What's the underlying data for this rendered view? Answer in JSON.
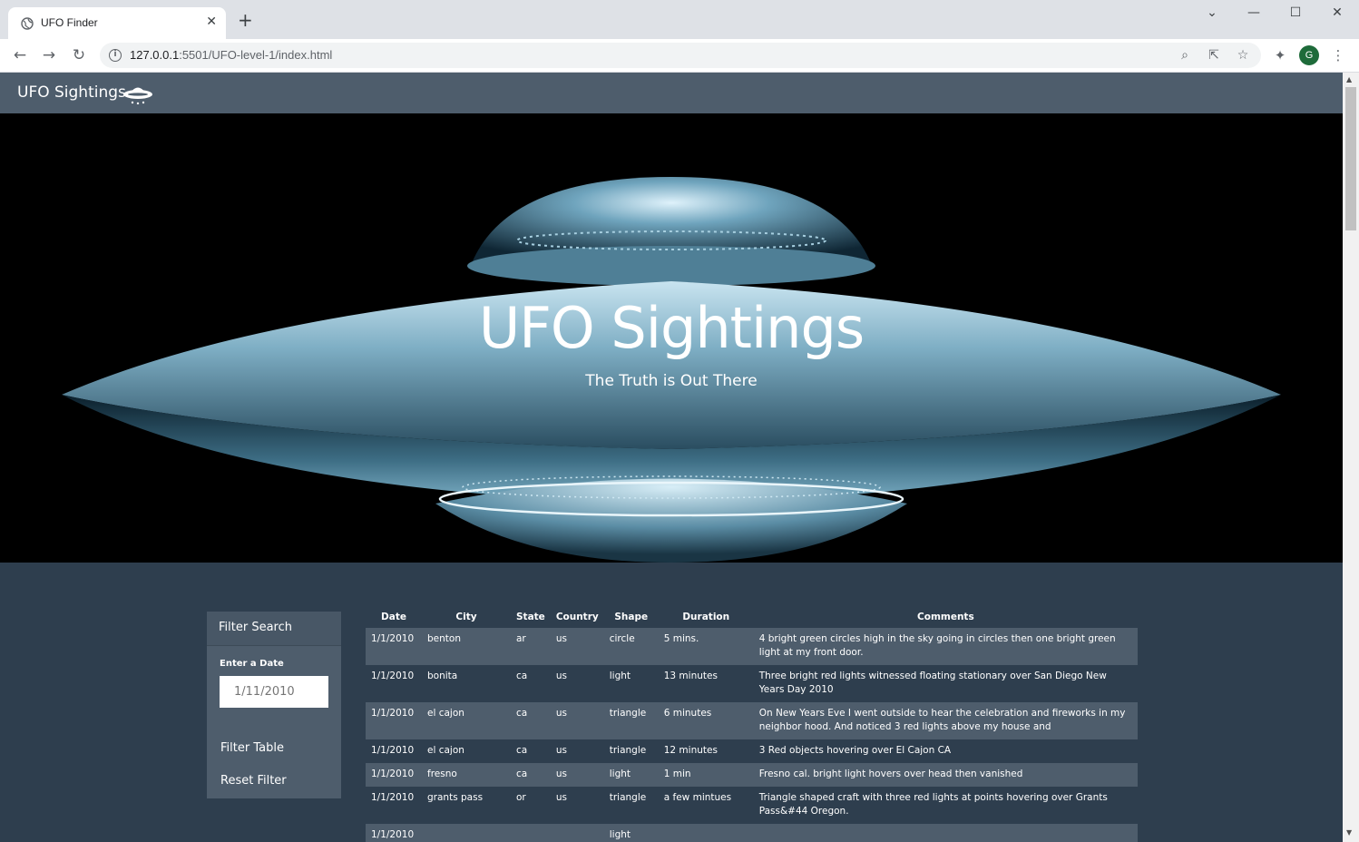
{
  "browser": {
    "tab_title": "UFO Finder",
    "tab_close": "✕",
    "new_tab": "+",
    "url_host": "127.0.0.1",
    "url_rest": ":5501/UFO-level-1/index.html",
    "avatar_letter": "G"
  },
  "navbar": {
    "brand": "UFO Sightings"
  },
  "hero": {
    "title": "UFO Sightings",
    "subtitle": "The Truth is Out There"
  },
  "filter": {
    "header": "Filter Search",
    "date_label": "Enter a Date",
    "date_placeholder": "1/11/2010",
    "filter_button": "Filter Table",
    "reset_button": "Reset Filter"
  },
  "table": {
    "headers": [
      "Date",
      "City",
      "State",
      "Country",
      "Shape",
      "Duration",
      "Comments"
    ],
    "rows": [
      [
        "1/1/2010",
        "benton",
        "ar",
        "us",
        "circle",
        "5 mins.",
        "4 bright green circles high in the sky going in circles then one bright green light at my front door."
      ],
      [
        "1/1/2010",
        "bonita",
        "ca",
        "us",
        "light",
        "13 minutes",
        "Three bright red lights witnessed floating stationary over San Diego New Years Day 2010"
      ],
      [
        "1/1/2010",
        "el cajon",
        "ca",
        "us",
        "triangle",
        "6 minutes",
        "On New Years Eve I went outside to hear the celebration and fireworks in my neighbor hood. And noticed 3 red lights above my house and"
      ],
      [
        "1/1/2010",
        "el cajon",
        "ca",
        "us",
        "triangle",
        "12 minutes",
        "3 Red objects hovering over El Cajon CA"
      ],
      [
        "1/1/2010",
        "fresno",
        "ca",
        "us",
        "light",
        "1 min",
        "Fresno cal. bright light hovers over head then vanished"
      ],
      [
        "1/1/2010",
        "grants pass",
        "or",
        "us",
        "triangle",
        "a few mintues",
        "Triangle shaped craft with three red lights at points hovering over Grants Pass&#44 Oregon."
      ],
      [
        "1/1/2010",
        "",
        "",
        "",
        "light",
        "",
        ""
      ]
    ]
  },
  "colors": {
    "page_bg": "#2e3e4e",
    "navbar_bg": "#4e5d6c",
    "row_alt": "#4e5d6c"
  }
}
